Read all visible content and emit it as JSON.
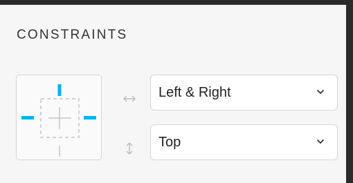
{
  "section": {
    "title": "CONSTRAINTS"
  },
  "constraints": {
    "accent_color": "#00b4f0",
    "horizontal": {
      "icon": "horizontal-arrows-icon",
      "selected": "Left & Right"
    },
    "vertical": {
      "icon": "vertical-arrows-icon",
      "selected": "Top"
    }
  }
}
